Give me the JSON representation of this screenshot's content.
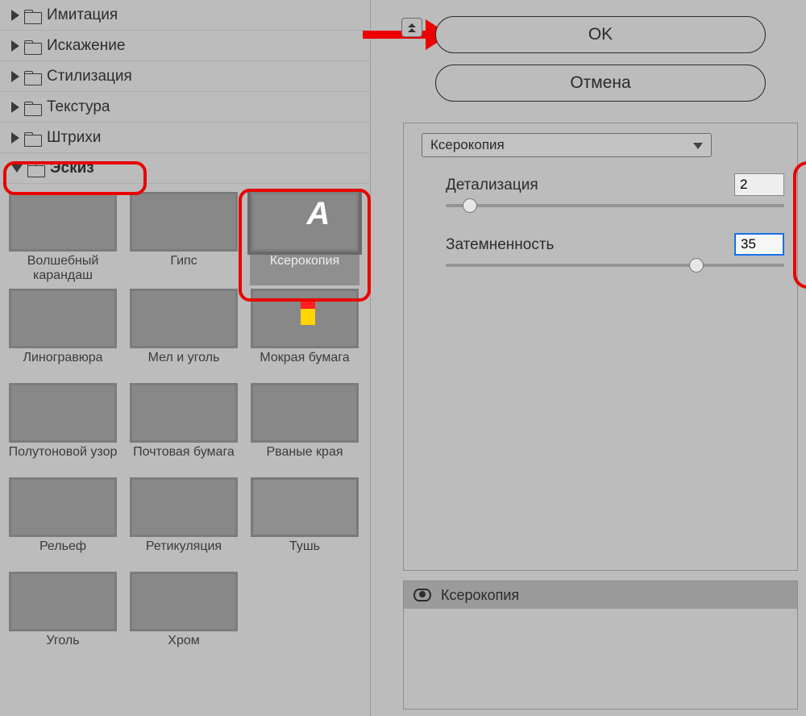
{
  "buttons": {
    "ok": "OK",
    "cancel": "Отмена"
  },
  "categories": [
    {
      "label": "Имитация",
      "open": false
    },
    {
      "label": "Искажение",
      "open": false
    },
    {
      "label": "Стилизация",
      "open": false
    },
    {
      "label": "Текстура",
      "open": false
    },
    {
      "label": "Штрихи",
      "open": false
    },
    {
      "label": "Эскиз",
      "open": true
    }
  ],
  "filters": [
    {
      "label": "Волшебный карандаш"
    },
    {
      "label": "Гипс"
    },
    {
      "label": "Ксерокопия",
      "selected": true
    },
    {
      "label": "Линогравюра"
    },
    {
      "label": "Мел и уголь"
    },
    {
      "label": "Мокрая бумага"
    },
    {
      "label": "Полутоновой узор"
    },
    {
      "label": "Почтовая бумага"
    },
    {
      "label": "Рваные края"
    },
    {
      "label": "Рельеф"
    },
    {
      "label": "Ретикуляция"
    },
    {
      "label": "Тушь"
    },
    {
      "label": "Уголь"
    },
    {
      "label": "Хром"
    }
  ],
  "dropdown": {
    "selected": "Ксерокопия"
  },
  "params": {
    "detail": {
      "label": "Детализация",
      "value": "2",
      "pos_pct": 5
    },
    "darkness": {
      "label": "Затемненность",
      "value": "35",
      "pos_pct": 72,
      "focused": true
    }
  },
  "layer": {
    "name": "Ксерокопия"
  }
}
